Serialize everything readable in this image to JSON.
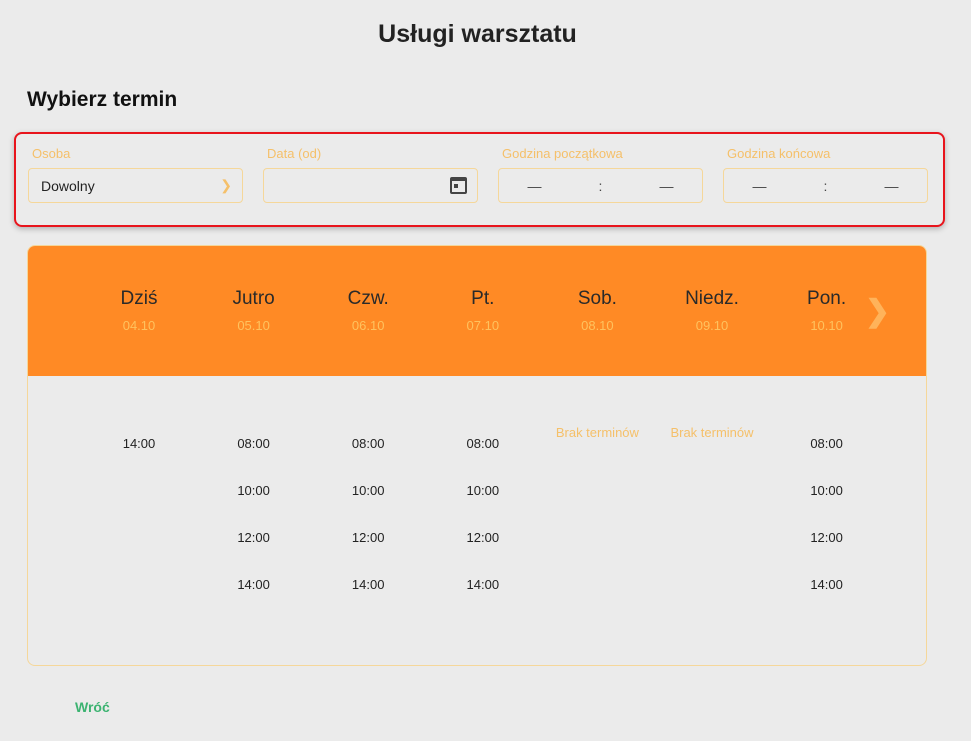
{
  "title": "Usługi warsztatu",
  "subtitle": "Wybierz termin",
  "filters": {
    "person": {
      "label": "Osoba",
      "value": "Dowolny"
    },
    "date": {
      "label": "Data (od)",
      "value": ""
    },
    "start": {
      "label": "Godzina początkowa",
      "hour": "—",
      "sep": ":",
      "minute": "—"
    },
    "end": {
      "label": "Godzina końcowa",
      "hour": "—",
      "sep": ":",
      "minute": "—"
    }
  },
  "days": [
    {
      "name": "Dziś",
      "date": "04.10",
      "slots": [
        "14:00"
      ]
    },
    {
      "name": "Jutro",
      "date": "05.10",
      "slots": [
        "08:00",
        "10:00",
        "12:00",
        "14:00"
      ]
    },
    {
      "name": "Czw.",
      "date": "06.10",
      "slots": [
        "08:00",
        "10:00",
        "12:00",
        "14:00"
      ]
    },
    {
      "name": "Pt.",
      "date": "07.10",
      "slots": [
        "08:00",
        "10:00",
        "12:00",
        "14:00"
      ]
    },
    {
      "name": "Sob.",
      "date": "08.10",
      "slots": [],
      "empty": "Brak terminów"
    },
    {
      "name": "Niedz.",
      "date": "09.10",
      "slots": [],
      "empty": "Brak terminów"
    },
    {
      "name": "Pon.",
      "date": "10.10",
      "slots": [
        "08:00",
        "10:00",
        "12:00",
        "14:00"
      ]
    }
  ],
  "back": "Wróć",
  "colors": {
    "accent": "#ff8a25",
    "highlight": "#e8141c",
    "link": "#3cb371"
  }
}
